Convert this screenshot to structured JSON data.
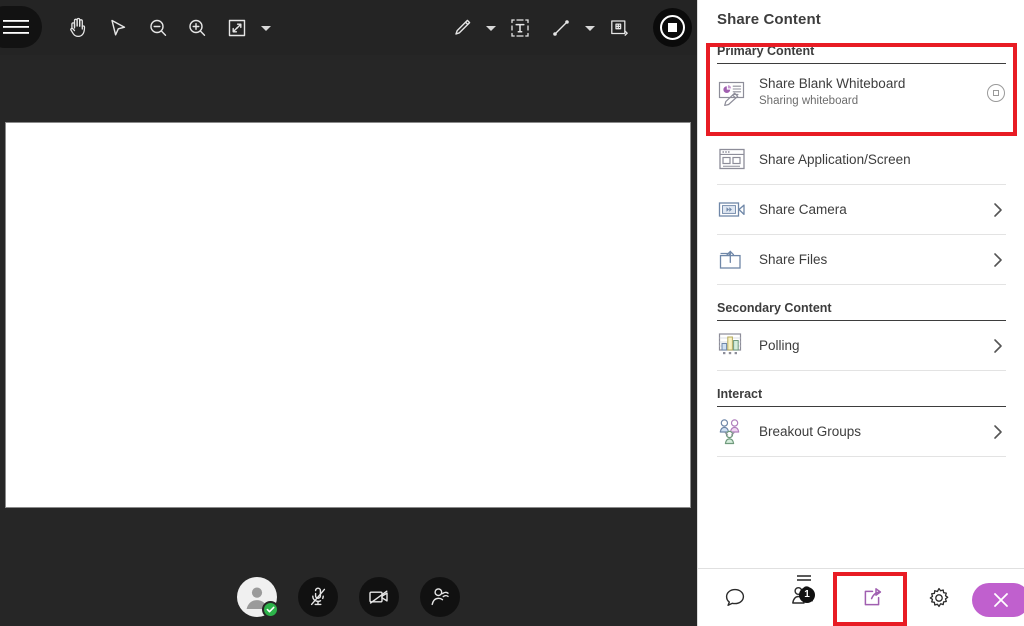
{
  "stage": {
    "top_toolbar": {
      "menu_icon": "hamburger-menu-icon",
      "tools": [
        {
          "name": "pan-hand-tool",
          "icon": "hand-icon"
        },
        {
          "name": "pointer-tool",
          "icon": "cursor-arrow-icon"
        },
        {
          "name": "zoom-out-tool",
          "icon": "magnifier-minus-icon"
        },
        {
          "name": "zoom-in-tool",
          "icon": "magnifier-plus-icon"
        },
        {
          "name": "fit-to-screen-tool",
          "icon": "expand-arrows-icon"
        },
        {
          "name": "view-options-caret",
          "icon": "chevron-down-icon"
        },
        {
          "name": "pen-tool",
          "icon": "pencil-icon"
        },
        {
          "name": "pen-options-caret",
          "icon": "chevron-down-icon"
        },
        {
          "name": "text-tool",
          "icon": "text-box-icon"
        },
        {
          "name": "line-tool",
          "icon": "line-icon"
        },
        {
          "name": "line-options-caret",
          "icon": "chevron-down-icon"
        },
        {
          "name": "stamp-tool",
          "icon": "image-stamp-icon"
        }
      ],
      "record_button": {
        "name": "stop-recording-button",
        "icon": "stop-square-icon"
      }
    },
    "whiteboard": {
      "name": "whiteboard-canvas",
      "content": ""
    },
    "bottom_controls": [
      {
        "name": "self-avatar",
        "icon": "person-avatar-icon",
        "status": "ready-check-icon"
      },
      {
        "name": "microphone-toggle",
        "icon": "microphone-muted-icon"
      },
      {
        "name": "camera-toggle",
        "icon": "camera-off-icon"
      },
      {
        "name": "raise-hand-button",
        "icon": "raise-hand-icon"
      }
    ]
  },
  "sidebar": {
    "title": "Share Content",
    "sections": [
      {
        "heading": "Primary Content",
        "items": [
          {
            "label": "Share Blank Whiteboard",
            "sublabel": "Sharing whiteboard",
            "icon": "whiteboard-pencil-icon",
            "action": "stop-sharing-button",
            "highlighted": true
          },
          {
            "label": "Share Application/Screen",
            "sublabel": "",
            "icon": "screen-share-icon",
            "action": "none"
          },
          {
            "label": "Share Camera",
            "sublabel": "",
            "icon": "video-camera-icon",
            "action": "chevron-right-icon"
          },
          {
            "label": "Share Files",
            "sublabel": "",
            "icon": "folder-upload-icon",
            "action": "chevron-right-icon"
          }
        ]
      },
      {
        "heading": "Secondary Content",
        "items": [
          {
            "label": "Polling",
            "sublabel": "",
            "icon": "bar-chart-icon",
            "action": "chevron-right-icon"
          }
        ]
      },
      {
        "heading": "Interact",
        "items": [
          {
            "label": "Breakout Groups",
            "sublabel": "",
            "icon": "people-groups-icon",
            "action": "chevron-right-icon"
          }
        ]
      }
    ],
    "bottom_bar": {
      "chat": {
        "name": "chat-button",
        "icon": "speech-bubble-icon"
      },
      "participants": {
        "name": "participants-button",
        "icon": "people-icon",
        "badge": "1"
      },
      "share": {
        "name": "share-content-button",
        "icon": "share-arrow-icon",
        "highlighted": true
      },
      "settings": {
        "name": "settings-button",
        "icon": "gear-icon"
      },
      "close": {
        "name": "close-panel-button",
        "icon": "close-x-icon"
      }
    }
  },
  "colors": {
    "stage_bg": "#262626",
    "toolbar_bg": "#242424",
    "panel_bg": "#ffffff",
    "highlight_red": "#e81c24",
    "close_purple": "#c060ce",
    "status_green": "#2db34a",
    "text_primary": "#3d3d3d",
    "text_secondary": "#6d6d6d"
  }
}
